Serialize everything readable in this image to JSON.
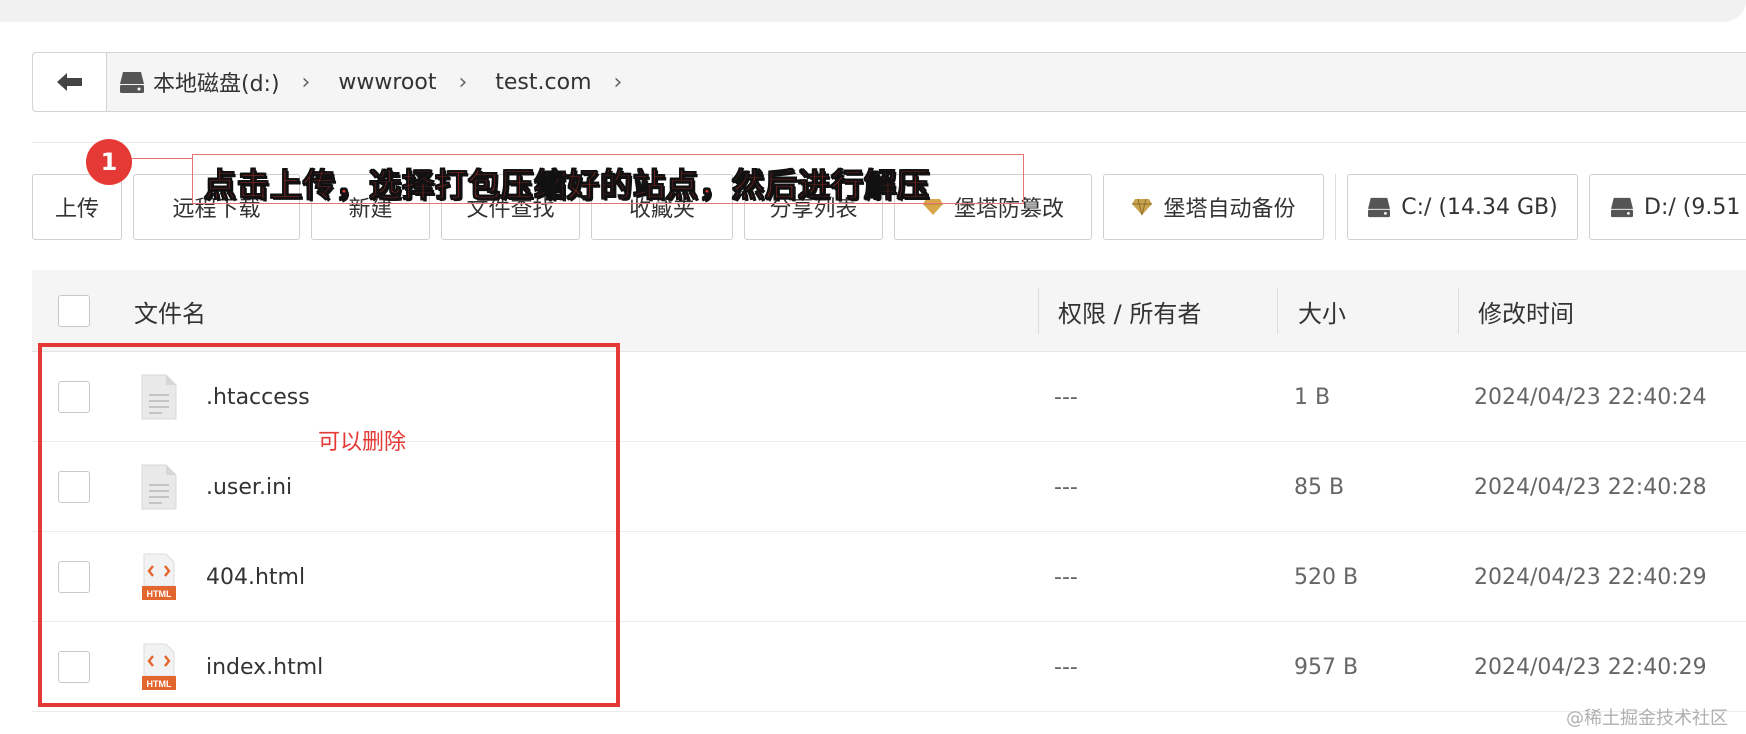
{
  "breadcrumb": {
    "back_icon": "arrow-left-icon",
    "disk_icon": "hard-drive-icon",
    "items": [
      "本地磁盘(d:)",
      "wwwroot",
      "test.com"
    ],
    "separator": "›"
  },
  "toolbar": {
    "upload": "上传",
    "remote_download": "远程下载",
    "new": "新建",
    "file_search": "文件查找",
    "favorites": "收藏夹",
    "share_list": "分享列表",
    "tamper_proof": "堡塔防篡改",
    "auto_backup": "堡塔自动备份",
    "disk_c": "C:/ (14.34 GB)",
    "disk_d": "D:/ (9.51"
  },
  "annotation": {
    "badge": "1",
    "text": "点击上传，选择打包压缩好的站点，然后进行解压",
    "accent_color": "#e53935"
  },
  "table": {
    "headers": {
      "name": "文件名",
      "perm": "权限 / 所有者",
      "size": "大小",
      "mtime": "修改时间"
    },
    "rows": [
      {
        "name": ".htaccess",
        "perm": "---",
        "size": "1 B",
        "mtime": "2024/04/23 22:40:24",
        "icon": "text-file-icon"
      },
      {
        "name": ".user.ini",
        "perm": "---",
        "size": "85 B",
        "mtime": "2024/04/23 22:40:28",
        "icon": "text-file-icon"
      },
      {
        "name": "404.html",
        "perm": "---",
        "size": "520 B",
        "mtime": "2024/04/23 22:40:29",
        "icon": "html-file-icon"
      },
      {
        "name": "index.html",
        "perm": "---",
        "size": "957 B",
        "mtime": "2024/04/23 22:40:29",
        "icon": "html-file-icon"
      }
    ],
    "html_badge": "HTML"
  },
  "note": "可以删除",
  "watermark": "@稀土掘金技术社区"
}
